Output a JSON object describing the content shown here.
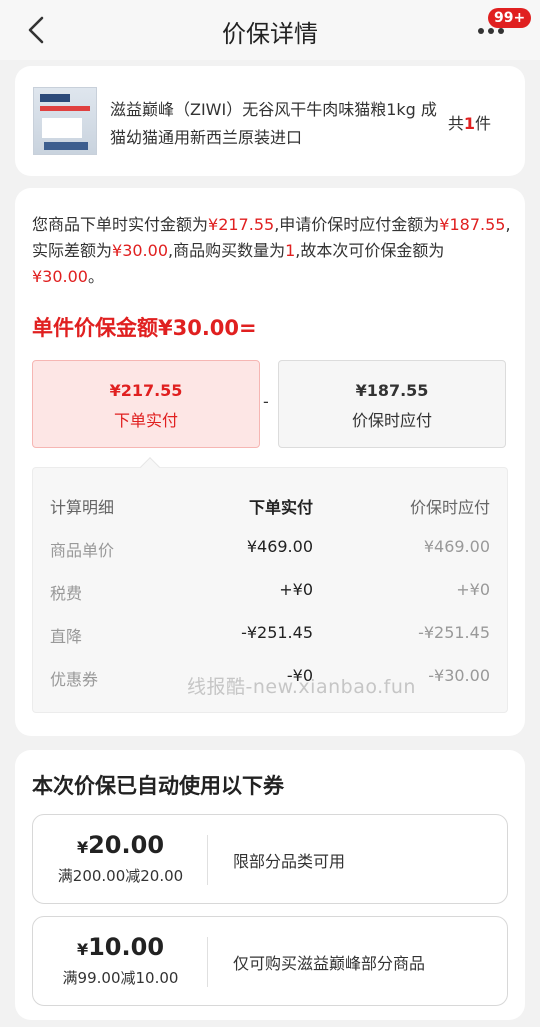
{
  "header": {
    "title": "价保详情",
    "badge": "99+"
  },
  "product": {
    "name": "滋益巅峰（ZIWI）无谷风干牛肉味猫粮1kg 成猫幼猫通用新西兰原装进口",
    "qty_prefix": "共",
    "qty_num": "1",
    "qty_suffix": "件"
  },
  "detail": {
    "desc": [
      {
        "t": "您商品下单时实付金额为",
        "red": false
      },
      {
        "t": "¥217.55",
        "red": true
      },
      {
        "t": ",申请价保时应付金额为",
        "red": false
      },
      {
        "t": "¥187.55",
        "red": true
      },
      {
        "t": ",实际差额为",
        "red": false
      },
      {
        "t": "¥30.00",
        "red": true
      },
      {
        "t": ",商品购买数量为",
        "red": false
      },
      {
        "t": "1",
        "red": true
      },
      {
        "t": ",故本次可价保金额为",
        "red": false
      },
      {
        "t": "¥30.00",
        "red": true
      },
      {
        "t": "。",
        "red": false
      }
    ],
    "unit_title": "单件价保金额¥30.00=",
    "paid_amount": "¥217.55",
    "paid_label": "下单实付",
    "minus": "-",
    "due_amount": "¥187.55",
    "due_label": "价保时应付",
    "table": {
      "headers": [
        "计算明细",
        "下单实付",
        "价保时应付"
      ],
      "rows": [
        [
          "商品单价",
          "¥469.00",
          "¥469.00"
        ],
        [
          "税费",
          "+¥0",
          "+¥0"
        ],
        [
          "直降",
          "-¥251.45",
          "-¥251.45"
        ],
        [
          "优惠券",
          "-¥0",
          "-¥30.00"
        ]
      ]
    },
    "watermark": "线报酷-new.xianbao.fun"
  },
  "coupons": {
    "title": "本次价保已自动使用以下券",
    "items": [
      {
        "yen": "¥",
        "amount": "20.00",
        "condition": "满200.00减20.00",
        "scope": "限部分品类可用"
      },
      {
        "yen": "¥",
        "amount": "10.00",
        "condition": "满99.00减10.00",
        "scope": "仅可购买滋益巅峰部分商品"
      }
    ]
  }
}
